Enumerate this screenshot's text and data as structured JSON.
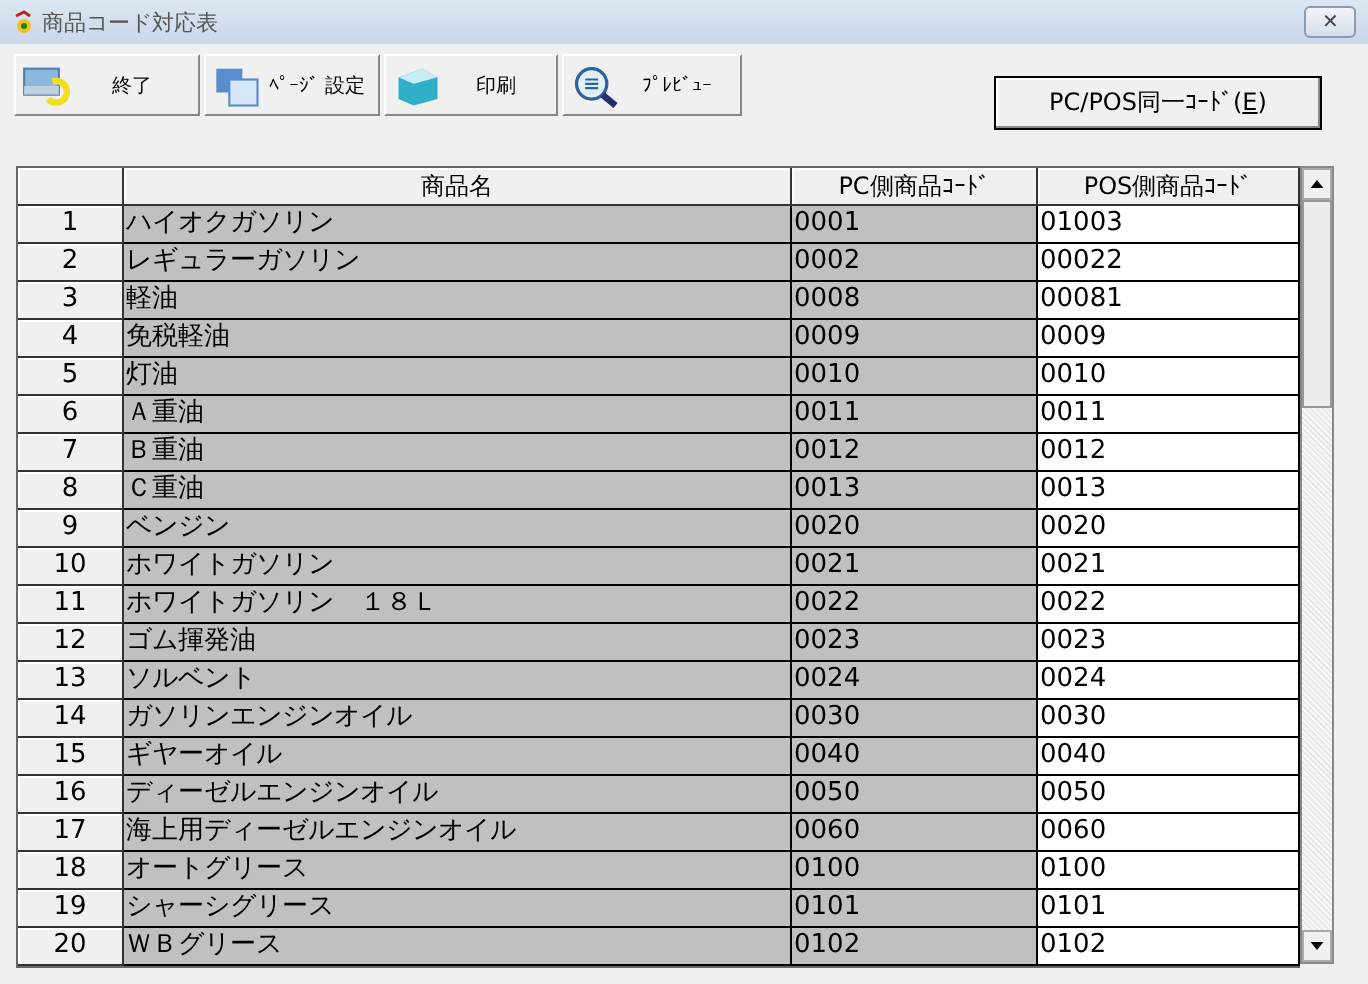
{
  "window": {
    "title": "商品コード対応表",
    "close": "✕"
  },
  "toolbar": [
    {
      "kind": "exit",
      "label": "終了"
    },
    {
      "kind": "page",
      "label": "ﾍﾟｰｼﾞ 設定"
    },
    {
      "kind": "print",
      "label": "印刷"
    },
    {
      "kind": "preview",
      "label": "ﾌﾟﾚﾋﾞｭｰ"
    }
  ],
  "same_code_button": {
    "label_before": "PC/POS同一ｺｰﾄﾞ(",
    "mnemonic": "E",
    "label_after": ")"
  },
  "table": {
    "columns": [
      {
        "label": "商品名",
        "editable": false
      },
      {
        "label": "PC側商品ｺｰﾄﾞ",
        "editable": false
      },
      {
        "label": "POS側商品ｺｰﾄﾞ",
        "editable": true
      }
    ],
    "rows": [
      [
        "1",
        "ハイオクガソリン",
        "0001",
        "01003"
      ],
      [
        "2",
        "レギュラーガソリン",
        "0002",
        "00022"
      ],
      [
        "3",
        "軽油",
        "0008",
        "00081"
      ],
      [
        "4",
        "免税軽油",
        "0009",
        "0009"
      ],
      [
        "5",
        "灯油",
        "0010",
        "0010"
      ],
      [
        "6",
        "Ａ重油",
        "0011",
        "0011"
      ],
      [
        "7",
        "Ｂ重油",
        "0012",
        "0012"
      ],
      [
        "8",
        "Ｃ重油",
        "0013",
        "0013"
      ],
      [
        "9",
        "ベンジン",
        "0020",
        "0020"
      ],
      [
        "10",
        "ホワイトガソリン",
        "0021",
        "0021"
      ],
      [
        "11",
        "ホワイトガソリン　１８Ｌ",
        "0022",
        "0022"
      ],
      [
        "12",
        "ゴム揮発油",
        "0023",
        "0023"
      ],
      [
        "13",
        "ソルベント",
        "0024",
        "0024"
      ],
      [
        "14",
        "ガソリンエンジンオイル",
        "0030",
        "0030"
      ],
      [
        "15",
        "ギヤーオイル",
        "0040",
        "0040"
      ],
      [
        "16",
        "ディーゼルエンジンオイル",
        "0050",
        "0050"
      ],
      [
        "17",
        "海上用ディーゼルエンジンオイル",
        "0060",
        "0060"
      ],
      [
        "18",
        "オートグリース",
        "0100",
        "0100"
      ],
      [
        "19",
        "シャーシグリース",
        "0101",
        "0101"
      ],
      [
        "20",
        "ＷＢグリース",
        "0102",
        "0102"
      ]
    ]
  }
}
